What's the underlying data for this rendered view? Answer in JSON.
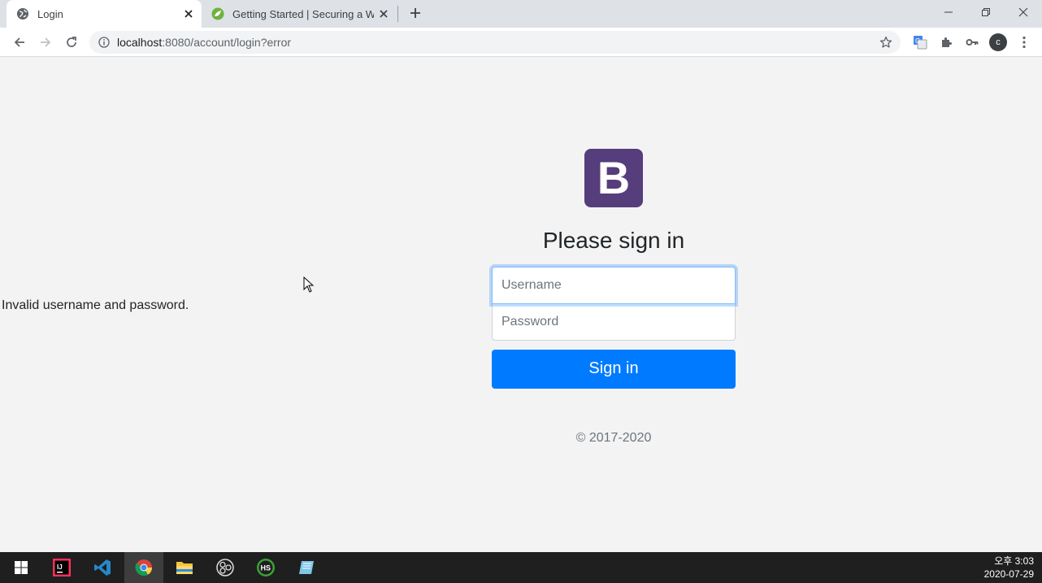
{
  "browser": {
    "tabs": [
      {
        "title": "Login",
        "favicon": "globe-icon",
        "active": true
      },
      {
        "title": "Getting Started | Securing a Web Application",
        "favicon": "spring-leaf-icon",
        "active": false
      }
    ],
    "url": {
      "host": "localhost",
      "path": ":8080/account/login?error"
    },
    "profile_initial": "c"
  },
  "page": {
    "error_message": "Invalid username and password.",
    "logo_letter": "B",
    "heading": "Please sign in",
    "username_placeholder": "Username",
    "password_placeholder": "Password",
    "submit_label": "Sign in",
    "copyright": "© 2017-2020"
  },
  "taskbar": {
    "apps": [
      "windows-start-icon",
      "intellij-icon",
      "vscode-icon",
      "chrome-icon",
      "file-explorer-icon",
      "obs-icon",
      "hs-icon",
      "notepad-icon"
    ],
    "active_app": "chrome-icon",
    "clock_time": "오후 3:03",
    "clock_date": "2020-07-29"
  },
  "colors": {
    "brand_purple": "#563d7c",
    "primary_blue": "#007bff",
    "page_background": "#f3f3f3",
    "taskbar": "#1f1f1f"
  }
}
